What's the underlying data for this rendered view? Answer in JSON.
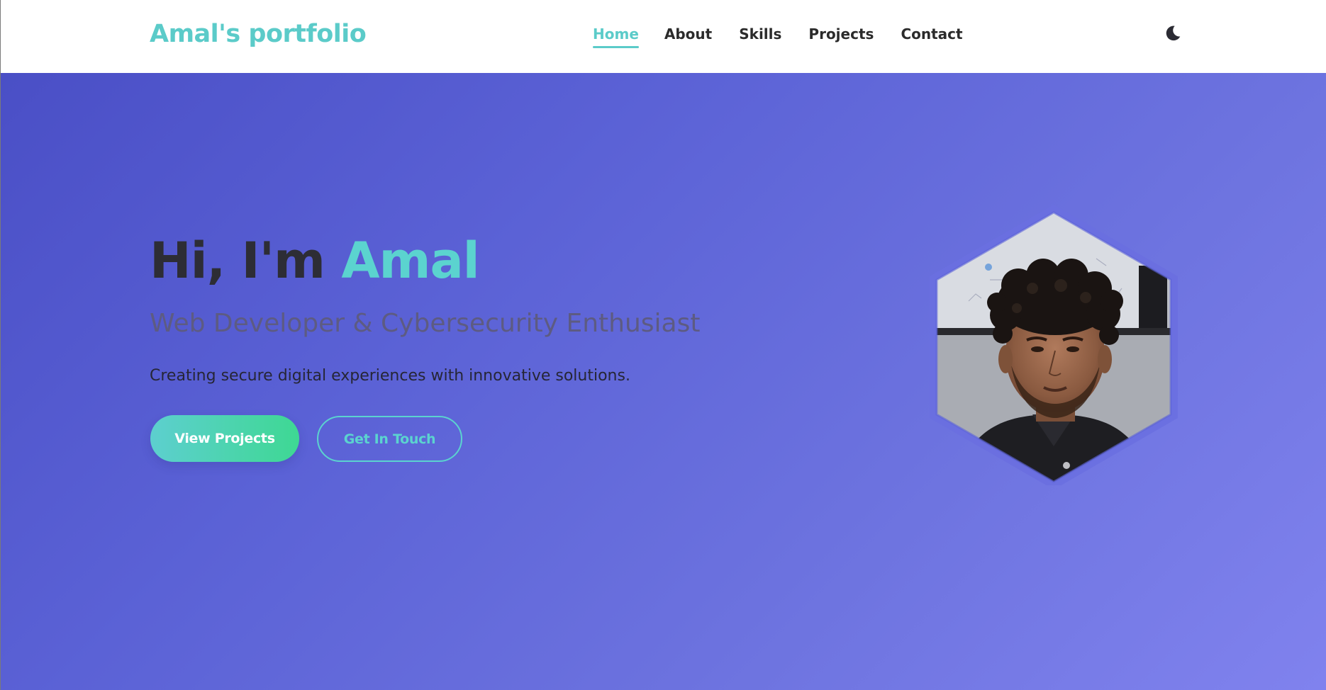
{
  "header": {
    "logo": "Amal's portfolio",
    "nav": [
      {
        "label": "Home",
        "active": true
      },
      {
        "label": "About",
        "active": false
      },
      {
        "label": "Skills",
        "active": false
      },
      {
        "label": "Projects",
        "active": false
      },
      {
        "label": "Contact",
        "active": false
      }
    ],
    "theme_toggle_icon": "moon-icon"
  },
  "hero": {
    "greeting": "Hi, I'm ",
    "name": "Amal",
    "subtitle": "Web Developer & Cybersecurity Enthusiast",
    "description": "Creating secure digital experiences with innovative solutions.",
    "primary_button": "View Projects",
    "secondary_button": "Get In Touch"
  },
  "colors": {
    "accent": "#5bcbc9",
    "hero_gradient_start": "#4a4fc6",
    "hero_gradient_end": "#8082ee",
    "primary_button_gradient_start": "#5dcfcf",
    "primary_button_gradient_end": "#3ed893",
    "heading_text": "#2d2d35"
  }
}
